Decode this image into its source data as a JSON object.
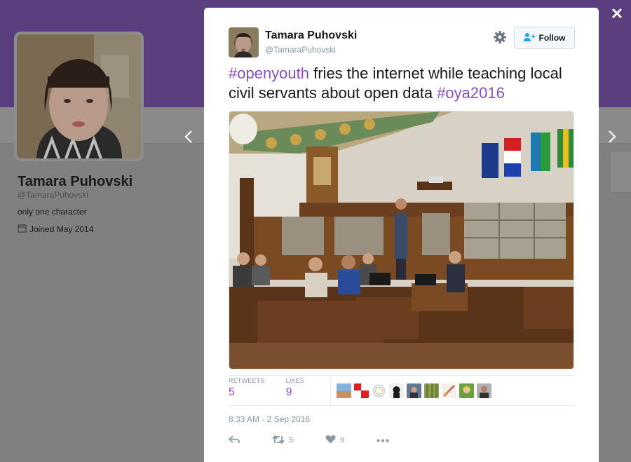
{
  "profile": {
    "name": "Tamara Puhovski",
    "handle": "@TamaraPuhovski",
    "bio": "only one character",
    "joined": "Joined May 2014"
  },
  "tweet": {
    "author_name": "Tamara Puhovski",
    "author_handle": "@TamaraPuhovski",
    "follow_label": "Follow",
    "text_parts": {
      "hashtag1": "#openyouth",
      "body": " fries the internet while teaching local civil servants about open data ",
      "hashtag2": "#oya2016"
    },
    "retweets_label": "RETWEETS",
    "retweets_count": "5",
    "likes_label": "LIKES",
    "likes_count": "9",
    "timestamp": "8:33 AM - 2 Sep 2016",
    "actions": {
      "retweet_count": "5",
      "like_count": "9"
    }
  },
  "icons": {
    "close": "close-icon",
    "prev": "chevron-left-icon",
    "next": "chevron-right-icon",
    "gear": "gear-icon",
    "follow": "add-user-icon",
    "calendar": "calendar-icon",
    "reply": "reply-icon",
    "retweet": "retweet-icon",
    "like": "heart-icon",
    "more": "more-icon"
  },
  "colors": {
    "accent": "#8b4ec4",
    "header": "#5b3e7e",
    "overlay": "#808080"
  }
}
